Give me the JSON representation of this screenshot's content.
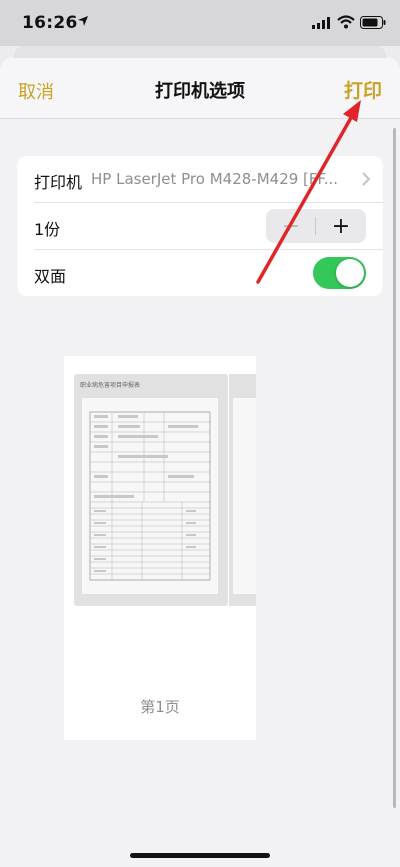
{
  "status_bar": {
    "time": "16:26",
    "icons": [
      "location-arrow-icon",
      "signal-icon",
      "wifi-icon",
      "battery-icon"
    ]
  },
  "nav": {
    "cancel_label": "取消",
    "title": "打印机选项",
    "print_label": "打印"
  },
  "options": {
    "printer_label": "打印机",
    "printer_value": "HP LaserJet Pro M428-M429 [FF...",
    "copies_label": "1份",
    "stepper_minus": "−",
    "stepper_plus": "+",
    "duplex_label": "双面",
    "duplex_on": true
  },
  "preview": {
    "doc_header": "职业病危害项目申报表",
    "page_label": "第1页"
  },
  "colors": {
    "accent": "#c9a227",
    "toggle_on": "#34c759",
    "annotation": "#e0242a"
  }
}
